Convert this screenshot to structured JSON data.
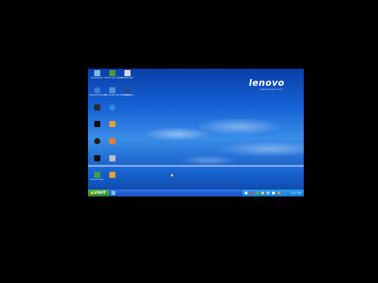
{
  "wallpaper": {
    "brand": "lenovo",
    "tagline": "www.lenovo.com"
  },
  "desktop_icons": [
    {
      "name": "recycle-bin-icon",
      "label": "Recycle Bin",
      "color": "#7ab8e8"
    },
    {
      "name": "share-your-ideas-icon",
      "label": "Share Your Ideas",
      "color": "#4a9a3a"
    },
    {
      "name": "net-file-icon",
      "label": "NETune_Rec",
      "color": "#d0d8e8"
    },
    {
      "name": "internet-explorer-icon",
      "label": "Internet Explorer",
      "color": "#3a7ed6"
    },
    {
      "name": "bonus-software-icon",
      "label": "Bonus Sponsorship Software",
      "color": "#5a8ad0"
    },
    {
      "name": "netflix-icon",
      "label": "Netflix",
      "color": "#2a4a8a"
    },
    {
      "name": "media-player-icon",
      "label": "",
      "color": "#2a2a2a"
    },
    {
      "name": "skype-icon",
      "label": "",
      "color": "#2a8ae0"
    },
    {
      "name": "game-icon",
      "label": "",
      "color": "#101010"
    },
    {
      "name": "app-icon-a",
      "label": "",
      "color": "#e0a030"
    },
    {
      "name": "camera-icon",
      "label": "",
      "color": "#202020"
    },
    {
      "name": "folder-app-icon",
      "label": "",
      "color": "#e08030"
    },
    {
      "name": "shortcut-icon",
      "label": "",
      "color": "#101010"
    },
    {
      "name": "program-icon",
      "label": "",
      "color": "#c0c0c0"
    },
    {
      "name": "lenovo-care-icon",
      "label": "Lenovo Care",
      "color": "#3aa04a"
    },
    {
      "name": "app-icon-b",
      "label": "",
      "color": "#e0a040"
    }
  ],
  "taskbar": {
    "start_label": "start",
    "clock": "4:17 PM"
  },
  "colors": {
    "accent": "#2f7fe0",
    "taskbar": "#1f5fd6",
    "start": "#2e8b2a"
  }
}
